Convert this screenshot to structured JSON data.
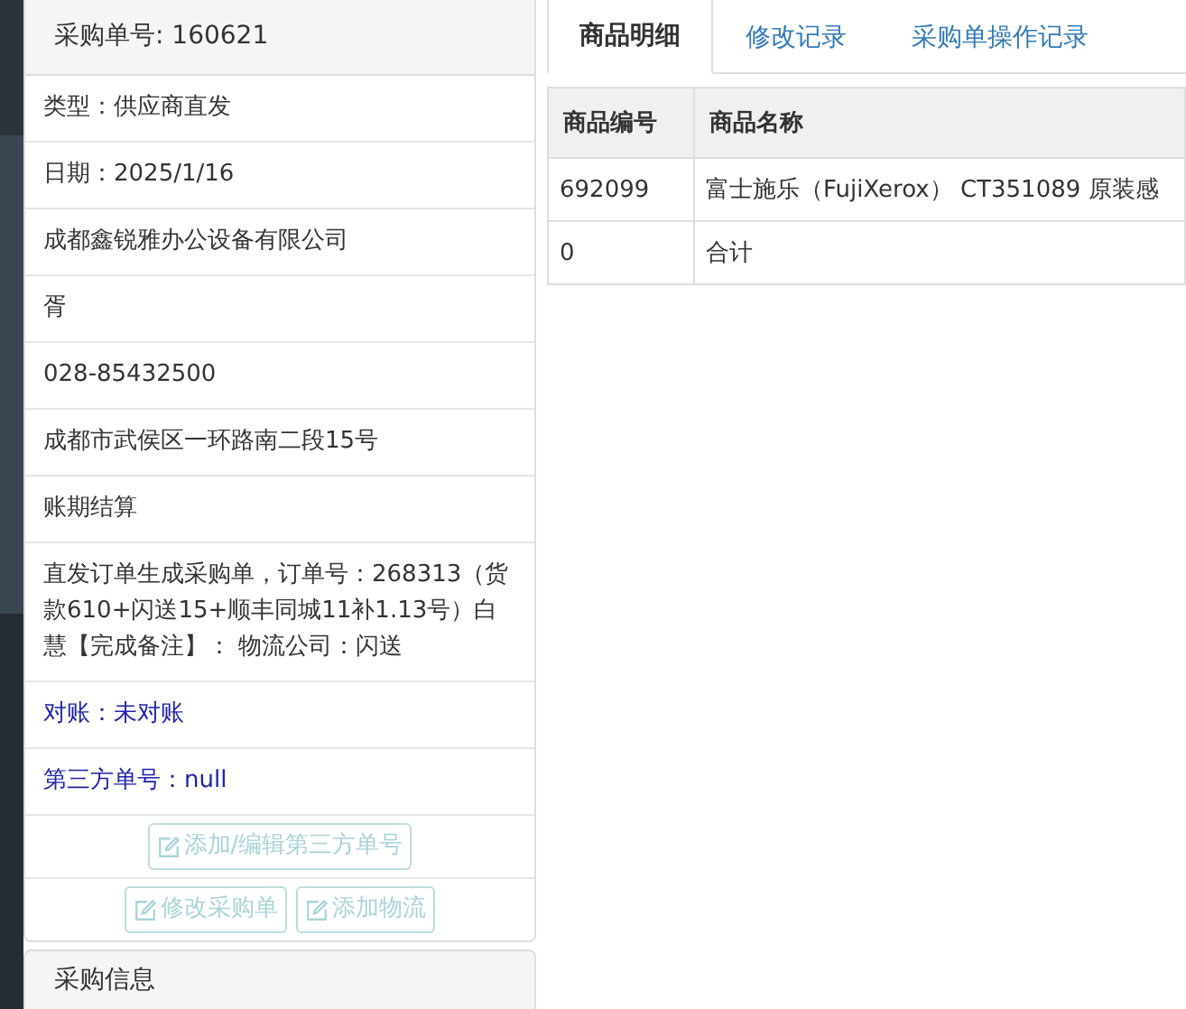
{
  "order_panel": {
    "title": "采购单号: 160621",
    "rows": [
      {
        "kind": "plain",
        "text": "类型：供应商直发"
      },
      {
        "kind": "plain",
        "text": "日期：2025/1/16"
      },
      {
        "kind": "plain",
        "text": "成都鑫锐雅办公设备有限公司"
      },
      {
        "kind": "plain",
        "text": "胥"
      },
      {
        "kind": "plain",
        "text": "028-85432500"
      },
      {
        "kind": "plain",
        "text": "成都市武侯区一环路南二段15号"
      },
      {
        "kind": "plain",
        "text": "账期结算"
      },
      {
        "kind": "plain",
        "text": "直发订单生成采购单，订单号：268313（货款610+闪送15+顺丰同城11补1.13号）白慧【完成备注】： 物流公司：闪送"
      },
      {
        "kind": "status",
        "text": "对账：未对账"
      },
      {
        "kind": "status",
        "text": "第三方单号：null"
      }
    ],
    "button_rows": [
      [
        {
          "label": "添加/编辑第三方单号",
          "disabled": true
        }
      ],
      [
        {
          "label": "修改采购单",
          "disabled": true
        },
        {
          "label": "添加物流",
          "disabled": true
        }
      ]
    ]
  },
  "next_panel": {
    "title": "采购信息"
  },
  "tabs": [
    {
      "label": "商品明细",
      "selected": true
    },
    {
      "label": "修改记录",
      "selected": false
    },
    {
      "label": "采购单操作记录",
      "selected": false
    }
  ],
  "table": {
    "columns": [
      "商品编号",
      "商品名称"
    ],
    "rows": [
      [
        "692099",
        "富士施乐（FujiXerox） CT351089 原装感"
      ],
      [
        "0",
        "合计"
      ]
    ]
  }
}
